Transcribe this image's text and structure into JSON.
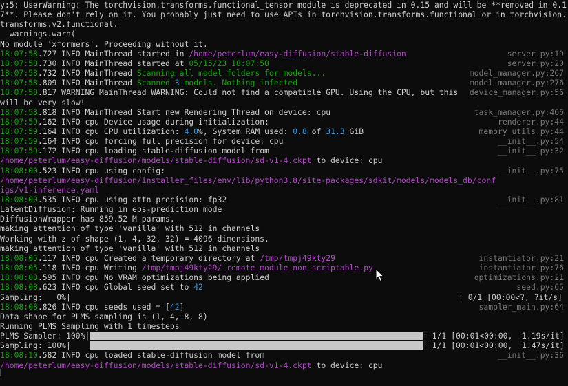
{
  "terminal": {
    "lines": [
      {
        "segs": [
          {
            "t": "y:5: UserWarning: The torchvision.transforms.functional_tensor module is deprecated in 0.15 and will be **removed in 0.1",
            "c": ""
          }
        ],
        "src": ""
      },
      {
        "segs": [
          {
            "t": "7**. Please don't rely on it. You probably just need to use APIs in torchvision.transforms.functional or in torchvision.",
            "c": ""
          }
        ],
        "src": ""
      },
      {
        "segs": [
          {
            "t": "transforms.v2.functional.",
            "c": ""
          }
        ],
        "src": ""
      },
      {
        "segs": [
          {
            "t": "  warnings.warn(",
            "c": ""
          }
        ],
        "src": ""
      },
      {
        "segs": [
          {
            "t": "No module 'xformers'. Proceeding without it.",
            "c": ""
          }
        ],
        "src": ""
      },
      {
        "segs": [
          {
            "t": "18:07:58",
            "c": "green"
          },
          {
            "t": ".727 INFO MainThread started in ",
            "c": ""
          },
          {
            "t": "/home/peterlum/easy-diffusion/stable-diffusion",
            "c": "magenta"
          }
        ],
        "src": "server.py:19"
      },
      {
        "segs": [
          {
            "t": "18:07:58",
            "c": "green"
          },
          {
            "t": ".730 INFO MainThread started at ",
            "c": ""
          },
          {
            "t": "05/15/23 18:07:58",
            "c": "green"
          }
        ],
        "src": "server.py:20"
      },
      {
        "segs": [
          {
            "t": "18:07:58",
            "c": "green"
          },
          {
            "t": ".732 INFO MainThread ",
            "c": ""
          },
          {
            "t": "Scanning all model folders for models...",
            "c": "green"
          }
        ],
        "src": "model_manager.py:267"
      },
      {
        "segs": [
          {
            "t": "18:07:58",
            "c": "green"
          },
          {
            "t": ".809 INFO MainThread ",
            "c": ""
          },
          {
            "t": "Scanned ",
            "c": "green"
          },
          {
            "t": "3",
            "c": "cyan"
          },
          {
            "t": " models. Nothing infected",
            "c": "green"
          }
        ],
        "src": "model_manager.py:276"
      },
      {
        "segs": [
          {
            "t": "18:07:58",
            "c": "green"
          },
          {
            "t": ".817 WARNING MainThread WARNING: Could not find a compatible GPU. Using the CPU, but this",
            "c": ""
          }
        ],
        "src": "device_manager.py:56"
      },
      {
        "segs": [
          {
            "t": "will be very slow!",
            "c": ""
          }
        ],
        "src": ""
      },
      {
        "segs": [
          {
            "t": "18:07:58",
            "c": "green"
          },
          {
            "t": ".818 INFO MainThread Start new Rendering Thread on device: cpu",
            "c": ""
          }
        ],
        "src": "task_manager.py:466"
      },
      {
        "segs": [
          {
            "t": "18:07:59",
            "c": "green"
          },
          {
            "t": ".162 INFO cpu Device usage during initialization:",
            "c": ""
          }
        ],
        "src": "renderer.py:44"
      },
      {
        "segs": [
          {
            "t": "18:07:59",
            "c": "green"
          },
          {
            "t": ".164 INFO cpu CPU utilization: ",
            "c": ""
          },
          {
            "t": "4.0",
            "c": "cyan"
          },
          {
            "t": "%, System RAM used: ",
            "c": ""
          },
          {
            "t": "0.8",
            "c": "cyan"
          },
          {
            "t": " of ",
            "c": ""
          },
          {
            "t": "31.3",
            "c": "cyan"
          },
          {
            "t": " GiB",
            "c": ""
          }
        ],
        "src": "memory_utils.py:44"
      },
      {
        "segs": [
          {
            "t": "18:07:59",
            "c": "green"
          },
          {
            "t": ".164 INFO cpu forcing full precision for device: cpu",
            "c": ""
          }
        ],
        "src": "__init__.py:54"
      },
      {
        "segs": [
          {
            "t": "18:07:59",
            "c": "green"
          },
          {
            "t": ".172 INFO cpu loading stable-diffusion model from",
            "c": ""
          }
        ],
        "src": "__init__.py:32"
      },
      {
        "segs": [
          {
            "t": "/home/peterlum/easy-diffusion/models/stable-diffusion/sd-v1-4.ckpt",
            "c": "magenta"
          },
          {
            "t": " to device: cpu",
            "c": ""
          }
        ],
        "src": ""
      },
      {
        "segs": [
          {
            "t": "18:08:00",
            "c": "green"
          },
          {
            "t": ".523 INFO cpu using config:",
            "c": ""
          }
        ],
        "src": "__init__.py:75"
      },
      {
        "segs": [
          {
            "t": "/home/peterlum/easy-diffusion/installer_files/env/lib/python3.8/site-packages/sdkit/models/models_db/conf",
            "c": "magenta"
          }
        ],
        "src": ""
      },
      {
        "segs": [
          {
            "t": "igs/v1-inference.yaml",
            "c": "magenta"
          }
        ],
        "src": ""
      },
      {
        "segs": [
          {
            "t": "18:08:00",
            "c": "green"
          },
          {
            "t": ".535 INFO cpu using attn_precision: fp32",
            "c": ""
          }
        ],
        "src": "__init__.py:81"
      },
      {
        "segs": [
          {
            "t": "LatentDiffusion: Running in eps-prediction mode",
            "c": ""
          }
        ],
        "src": ""
      },
      {
        "segs": [
          {
            "t": "DiffusionWrapper has 859.52 M params.",
            "c": ""
          }
        ],
        "src": ""
      },
      {
        "segs": [
          {
            "t": "making attention of type 'vanilla' with 512 in_channels",
            "c": ""
          }
        ],
        "src": ""
      },
      {
        "segs": [
          {
            "t": "Working with z of shape (1, 4, 32, 32) = 4096 dimensions.",
            "c": ""
          }
        ],
        "src": ""
      },
      {
        "segs": [
          {
            "t": "making attention of type 'vanilla' with 512 in_channels",
            "c": ""
          }
        ],
        "src": ""
      },
      {
        "segs": [
          {
            "t": "18:08:05",
            "c": "green"
          },
          {
            "t": ".117 INFO cpu Created a temporary directory at ",
            "c": ""
          },
          {
            "t": "/tmp/tmpj49kty29",
            "c": "magenta"
          }
        ],
        "src": "instantiator.py:21"
      },
      {
        "segs": [
          {
            "t": "18:08:05",
            "c": "green"
          },
          {
            "t": ".118 INFO cpu Writing ",
            "c": ""
          },
          {
            "t": "/tmp/tmpj49kty29/_remote_module_non_scriptable.py",
            "c": "magenta"
          }
        ],
        "src": "instantiator.py:76"
      },
      {
        "segs": [
          {
            "t": "18:08:08",
            "c": "green"
          },
          {
            "t": ".595 INFO cpu No VRAM optimizations being applied",
            "c": ""
          }
        ],
        "src": "optimizations.py:21"
      },
      {
        "segs": [
          {
            "t": "18:08:08",
            "c": "green"
          },
          {
            "t": ".623 INFO cpu Global seed set to ",
            "c": ""
          },
          {
            "t": "42",
            "c": "cyan"
          }
        ],
        "src": "seed.py:65"
      },
      {
        "segs": [
          {
            "t": "Sampling:   0%|",
            "c": ""
          }
        ],
        "src": "| 0/1 [00:00<?, ?it/s]",
        "src_plain": true
      },
      {
        "segs": [
          {
            "t": "18:08:08",
            "c": "green"
          },
          {
            "t": ".826 INFO cpu seeds used = [",
            "c": ""
          },
          {
            "t": "42",
            "c": "cyan"
          },
          {
            "t": "]",
            "c": ""
          }
        ],
        "src": "sampler_main.py:64"
      },
      {
        "segs": [
          {
            "t": "Data shape for PLMS sampling is (1, 4, 8, 8)",
            "c": ""
          }
        ],
        "src": ""
      },
      {
        "segs": [
          {
            "t": "Running PLMS Sampling with 1 timesteps",
            "c": ""
          }
        ],
        "src": ""
      },
      {
        "segs": [
          {
            "t": "PLMS Sampler: 100%|",
            "c": ""
          }
        ],
        "src": "| 1/1 [00:01<00:00,  1.19s/it]",
        "src_plain": true,
        "progress": 1.0
      },
      {
        "segs": [
          {
            "t": "Sampling: 100%|",
            "c": ""
          }
        ],
        "src": "| 1/1 [00:01<00:00,  1.47s/it]",
        "src_plain": true,
        "progress": 1.0
      },
      {
        "segs": [
          {
            "t": "18:08:10",
            "c": "green"
          },
          {
            "t": ".582 INFO cpu loaded stable-diffusion model from",
            "c": ""
          }
        ],
        "src": "__init__.py:36"
      },
      {
        "segs": [
          {
            "t": "/home/peterlum/easy-diffusion/models/stable-diffusion/sd-v1-4.ckpt",
            "c": "magenta"
          },
          {
            "t": " to device: cpu",
            "c": ""
          }
        ],
        "src": ""
      }
    ]
  },
  "colors": {
    "background": "#0c0c0c",
    "text": "#cccccc",
    "timestamp_green": "#13a10e",
    "path_magenta": "#b148c6",
    "number_cyan": "#3a96dd",
    "source_gray": "#767676",
    "progress_fill": "#c8c8c8"
  },
  "icons": {
    "pointer": "mouse-pointer-icon",
    "caret": "text-cursor-icon"
  }
}
